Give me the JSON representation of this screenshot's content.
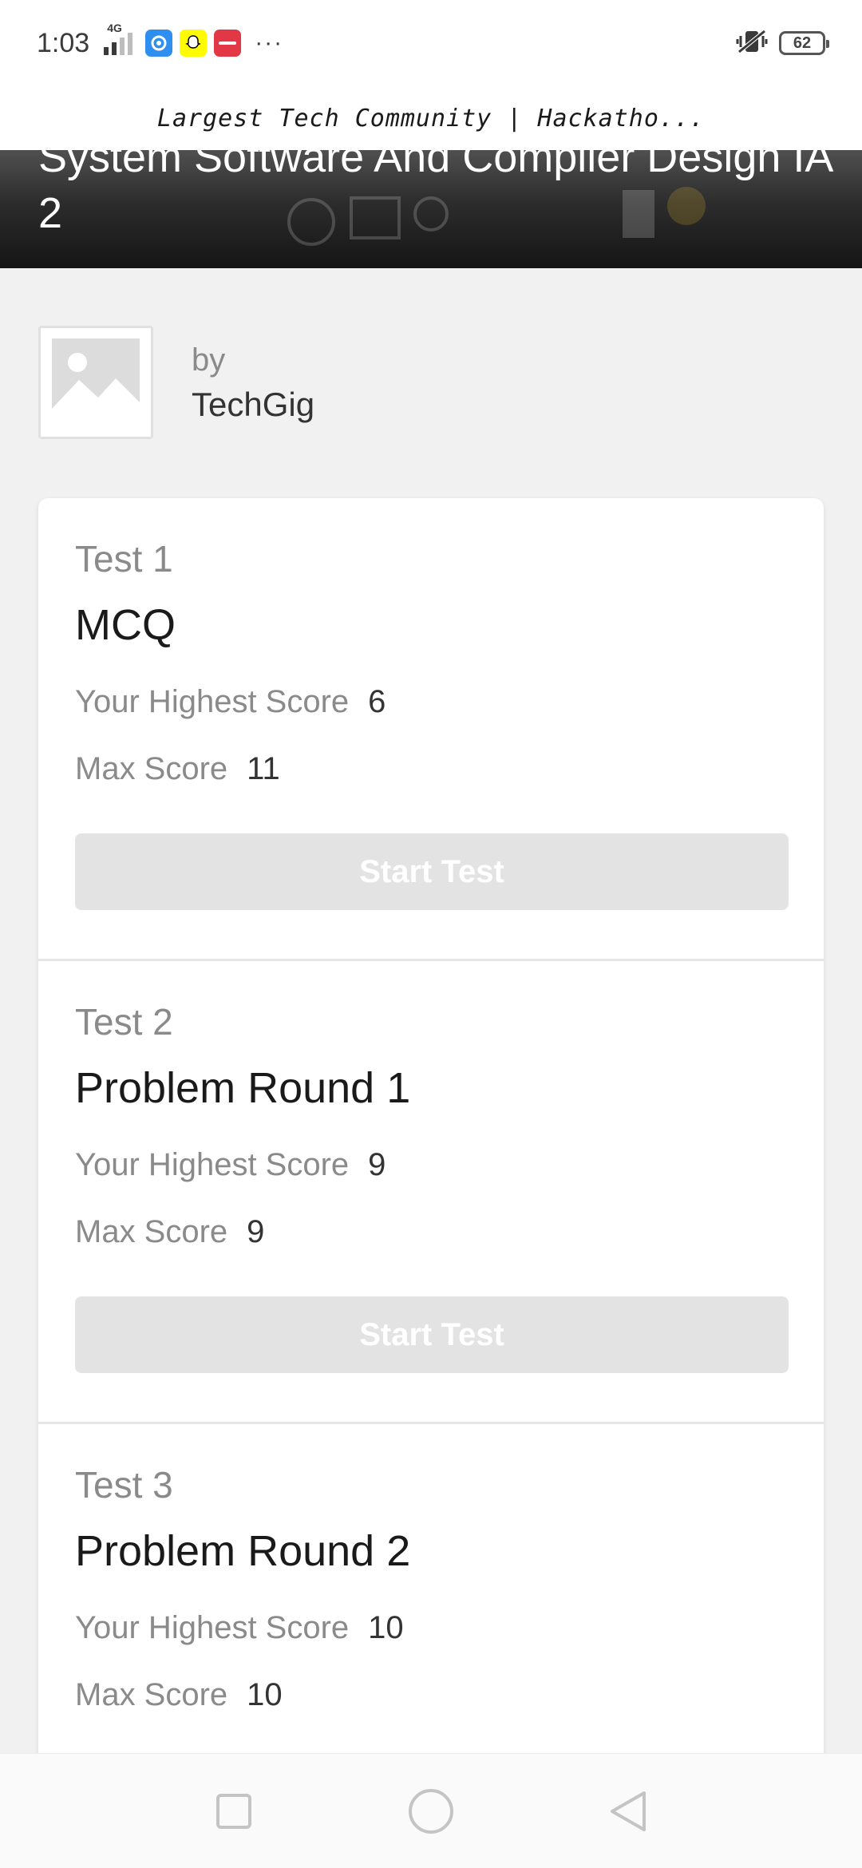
{
  "status_bar": {
    "time": "1:03",
    "network": "4G",
    "battery": "62"
  },
  "page": {
    "title": "Largest Tech Community | Hackatho..."
  },
  "hero": {
    "title": "System Software And Compiler Design IA 2"
  },
  "author": {
    "by_label": "by",
    "name": "TechGig"
  },
  "tests": [
    {
      "number": "Test 1",
      "name": "MCQ",
      "highest_label": "Your Highest Score",
      "highest_value": "6",
      "max_label": "Max Score",
      "max_value": "11",
      "button_label": "Start Test"
    },
    {
      "number": "Test 2",
      "name": "Problem Round 1",
      "highest_label": "Your Highest Score",
      "highest_value": "9",
      "max_label": "Max Score",
      "max_value": "9",
      "button_label": "Start Test"
    },
    {
      "number": "Test 3",
      "name": "Problem Round 2",
      "highest_label": "Your Highest Score",
      "highest_value": "10",
      "max_label": "Max Score",
      "max_value": "10"
    }
  ],
  "colors": {
    "button_disabled": "#e3e3e3",
    "label_gray": "#8a8a8a"
  },
  "icons": {
    "nav": [
      "recent-apps-icon",
      "home-icon",
      "back-icon"
    ],
    "placeholder": "image-placeholder-icon"
  }
}
